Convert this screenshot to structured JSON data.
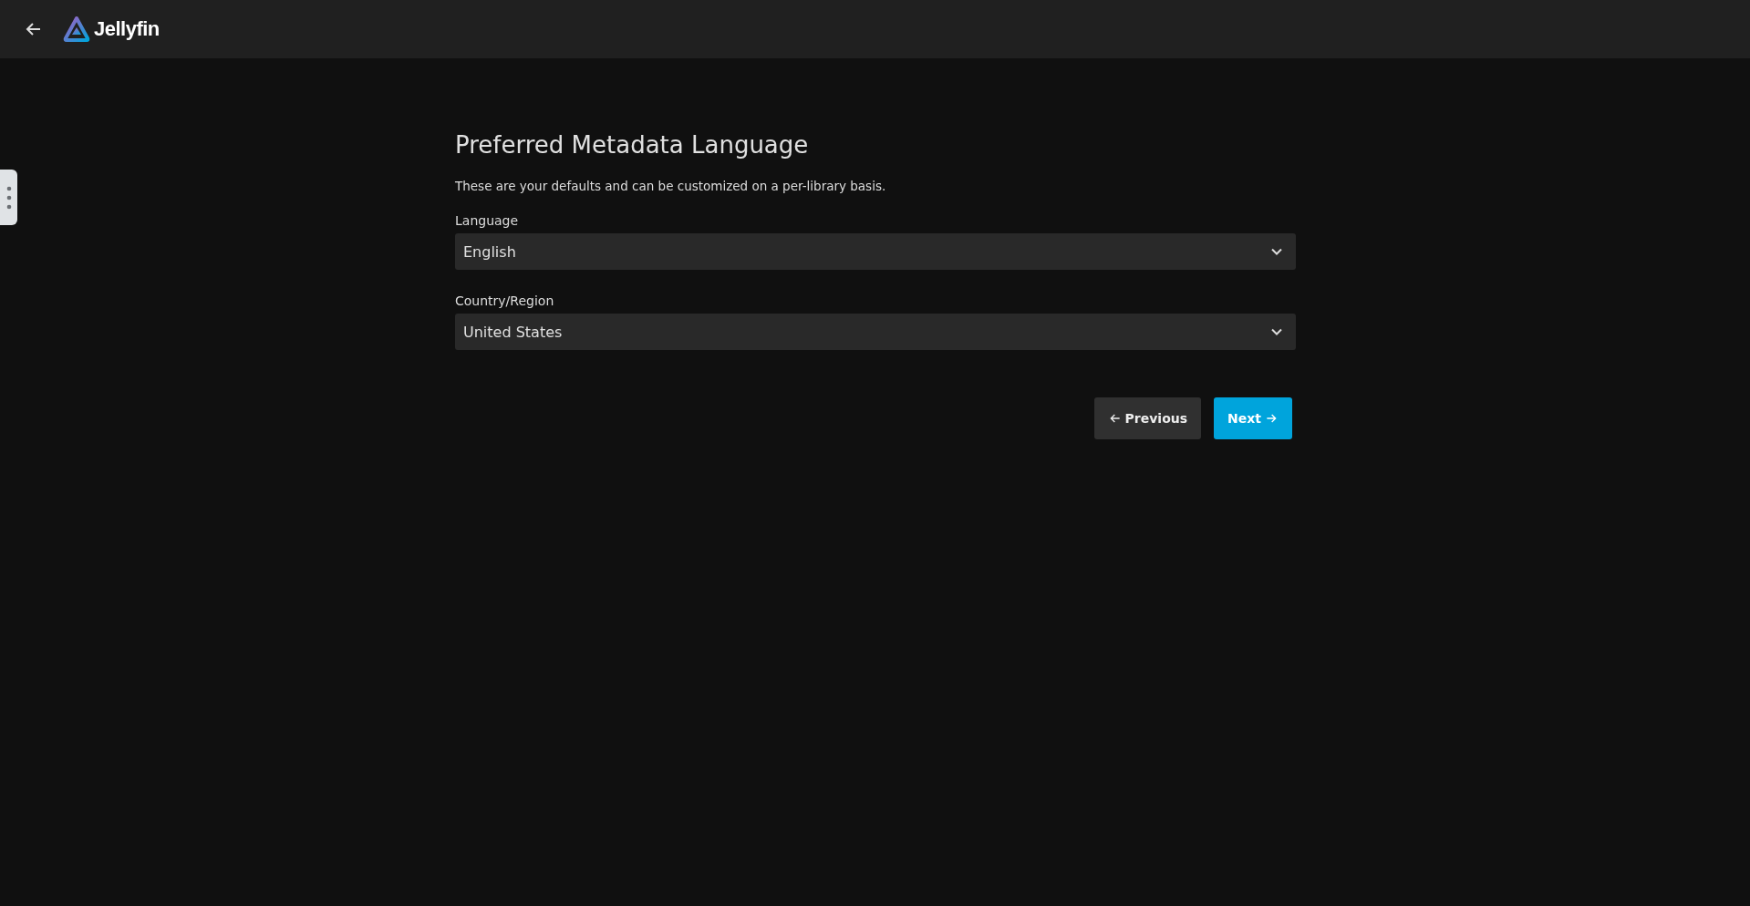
{
  "header": {
    "logo_text": "Jellyfin"
  },
  "page": {
    "title": "Preferred Metadata Language",
    "description": "These are your defaults and can be customized on a per-library basis."
  },
  "fields": [
    {
      "label": "Language",
      "value": "English"
    },
    {
      "label": "Country/Region",
      "value": "United States"
    }
  ],
  "buttons": [
    {
      "label": "Previous",
      "kind": "previous"
    },
    {
      "label": "Next",
      "kind": "next"
    }
  ]
}
